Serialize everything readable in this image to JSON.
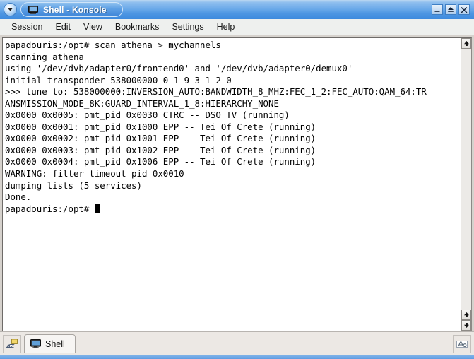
{
  "window": {
    "title": "Shell - Konsole",
    "title_icon": "monitor-icon",
    "window_menu_icon": "chevron-down-icon",
    "buttons": {
      "minimize": "minimize-icon",
      "maximize": "maximize-icon",
      "close": "close-icon"
    }
  },
  "menubar": {
    "items": [
      {
        "label": "Session"
      },
      {
        "label": "Edit"
      },
      {
        "label": "View"
      },
      {
        "label": "Bookmarks"
      },
      {
        "label": "Settings"
      },
      {
        "label": "Help"
      }
    ]
  },
  "terminal": {
    "lines": [
      "papadouris:/opt# scan athena > mychannels",
      "scanning athena",
      "using '/dev/dvb/adapter0/frontend0' and '/dev/dvb/adapter0/demux0'",
      "initial transponder 538000000 0 1 9 3 1 2 0",
      ">>> tune to: 538000000:INVERSION_AUTO:BANDWIDTH_8_MHZ:FEC_1_2:FEC_AUTO:QAM_64:TR",
      "ANSMISSION_MODE_8K:GUARD_INTERVAL_1_8:HIERARCHY_NONE",
      "0x0000 0x0005: pmt_pid 0x0030 CTRC -- DSO TV (running)",
      "0x0000 0x0001: pmt_pid 0x1000 EPP -- Tei Of Crete (running)",
      "0x0000 0x0002: pmt_pid 0x1001 EPP -- Tei Of Crete (running)",
      "0x0000 0x0003: pmt_pid 0x1002 EPP -- Tei Of Crete (running)",
      "0x0000 0x0004: pmt_pid 0x1006 EPP -- Tei Of Crete (running)",
      "WARNING: filter timeout pid 0x0010",
      "dumping lists (5 services)",
      "Done."
    ],
    "prompt": "papadouris:/opt# ",
    "cursor": "block-cursor"
  },
  "scrollbar": {
    "up_arrow": "scroll-up-icon",
    "down_arrow_top": "scroll-up-icon",
    "down_arrow_bottom": "scroll-down-icon"
  },
  "statusbar": {
    "new_session_button": "new-session-icon",
    "session_tab": {
      "label": "Shell",
      "icon": "monitor-icon"
    },
    "right_button": "text-size-icon"
  },
  "colors": {
    "titlebar_blue": "#5d9fe4",
    "titlebar_light": "#b9d6f2",
    "terminal_bg": "#ffffff",
    "terminal_fg": "#000000",
    "chrome_gray": "#ece8e4"
  }
}
